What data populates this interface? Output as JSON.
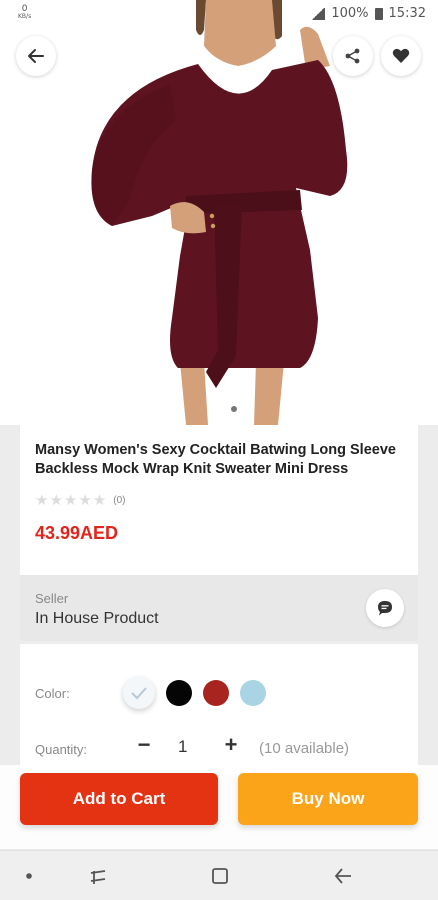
{
  "status_bar": {
    "net_speed": "0",
    "net_unit": "KB/s",
    "battery": "100%",
    "time": "15:32"
  },
  "product": {
    "title": "Mansy Women's Sexy Cocktail Batwing Long Sleeve Backless Mock Wrap Knit Sweater Mini Dress",
    "rating_count": "(0)",
    "stars": 0,
    "price": "43.99AED",
    "dress_color": "#5e1320"
  },
  "seller": {
    "label": "Seller",
    "name": "In House Product"
  },
  "options": {
    "color_label": "Color:",
    "colors": [
      "#f4f7fa",
      "#050505",
      "#a8241f",
      "#a8d4e4"
    ],
    "selected_color_index": 0,
    "quantity_label": "Quantity:",
    "quantity_value": "1",
    "quantity_minus": "−",
    "quantity_plus": "+",
    "available": "(10 available)"
  },
  "actions": {
    "add_to_cart": "Add to Cart",
    "buy_now": "Buy Now",
    "add_to_cart_color": "#e33312",
    "buy_now_color": "#fba41a"
  },
  "icons": {
    "back": "arrow-left-icon",
    "share": "share-icon",
    "favorite": "heart-icon",
    "chat": "chat-bubble-icon"
  }
}
